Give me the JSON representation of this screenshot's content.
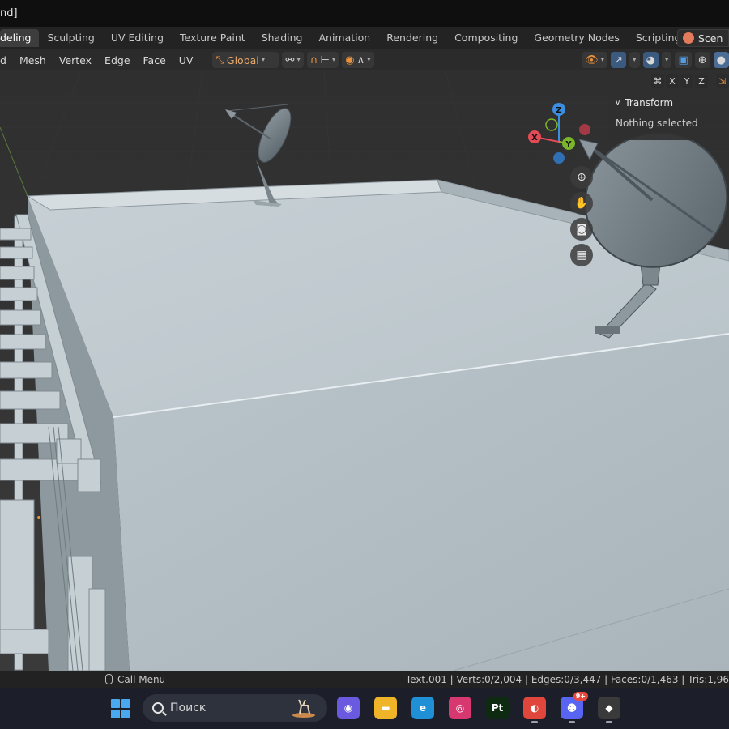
{
  "window": {
    "title": "nd]"
  },
  "workspace_tabs": [
    {
      "label": "deling",
      "active": true
    },
    {
      "label": "Sculpting"
    },
    {
      "label": "UV Editing"
    },
    {
      "label": "Texture Paint"
    },
    {
      "label": "Shading"
    },
    {
      "label": "Animation"
    },
    {
      "label": "Rendering"
    },
    {
      "label": "Compositing"
    },
    {
      "label": "Geometry Nodes"
    },
    {
      "label": "Scripting"
    }
  ],
  "add_workspace": "+",
  "scene": {
    "label": "Scen"
  },
  "header_menu": [
    "d",
    "Mesh",
    "Vertex",
    "Edge",
    "Face",
    "UV"
  ],
  "transform_orientation": {
    "label": "Global"
  },
  "axis_buttons": [
    "X",
    "Y",
    "Z"
  ],
  "npanel": {
    "title": "Transform",
    "message": "Nothing selected"
  },
  "gizmo": {
    "x": "X",
    "y": "Y",
    "z": "Z"
  },
  "statusbar": {
    "left": "Call Menu",
    "right": "Text.001 | Verts:0/2,004 | Edges:0/3,447 | Faces:0/1,463 | Tris:1,96"
  },
  "taskbar": {
    "search_placeholder": "Поиск",
    "apps": [
      {
        "name": "zoom",
        "color": "#6a5ae0",
        "glyph": "◉"
      },
      {
        "name": "files",
        "color": "#f0b429",
        "glyph": "▬"
      },
      {
        "name": "edge",
        "color": "#1f8fd6",
        "glyph": "e"
      },
      {
        "name": "instagram",
        "color": "#d6386f",
        "glyph": "◎"
      },
      {
        "name": "pt",
        "color": "#0e2a10",
        "glyph": "Pt"
      },
      {
        "name": "chrome",
        "color": "#e0463b",
        "glyph": "◐"
      },
      {
        "name": "discord",
        "color": "#5865f2",
        "glyph": "☻",
        "badge": "9+"
      },
      {
        "name": "blender",
        "color": "#3a3a3a",
        "glyph": "◆"
      }
    ]
  },
  "colors": {
    "accent": "#e8913d",
    "viewport": "#393939",
    "model": "#b9c5cc"
  }
}
